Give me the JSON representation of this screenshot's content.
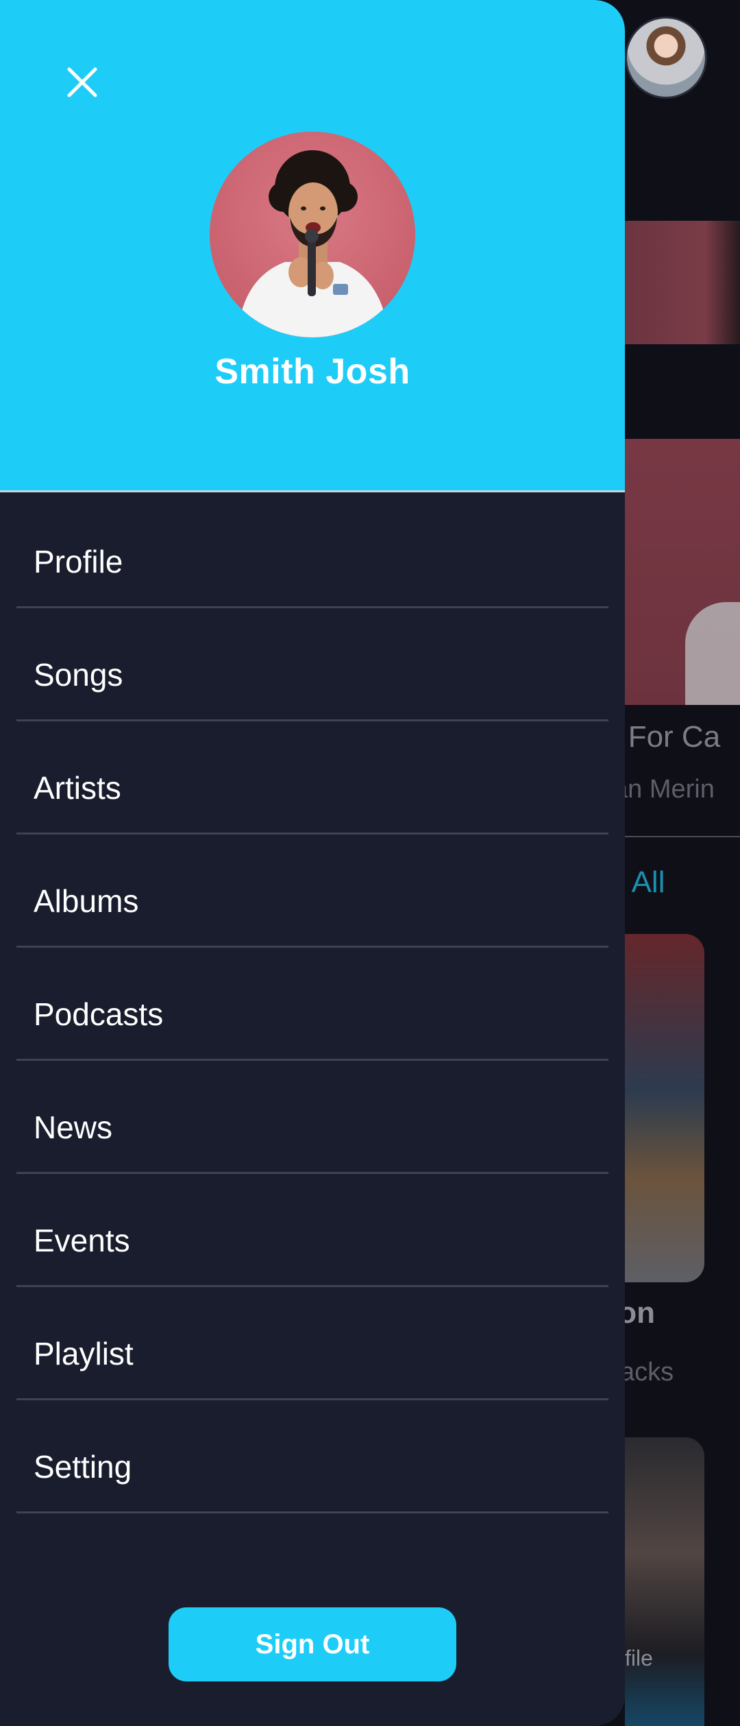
{
  "drawer": {
    "user_name": "Smith Josh",
    "menu": [
      {
        "label": "Profile"
      },
      {
        "label": "Songs"
      },
      {
        "label": "Artists"
      },
      {
        "label": "Albums"
      },
      {
        "label": "Podcasts"
      },
      {
        "label": "News"
      },
      {
        "label": "Events"
      },
      {
        "label": "Playlist"
      },
      {
        "label": "Setting"
      }
    ],
    "signout_label": "Sign Out"
  },
  "background": {
    "featured_song_title": "e For Ca",
    "featured_song_artist": "an Merin",
    "view_all_label": "w All",
    "card_title": "ion",
    "card_subtitle": "acks",
    "card_label": "file"
  },
  "colors": {
    "accent": "#1dcdf7",
    "drawer_bg": "#1a1d2d",
    "app_bg": "#0f0f18"
  },
  "icons": {
    "close": "close-icon"
  }
}
